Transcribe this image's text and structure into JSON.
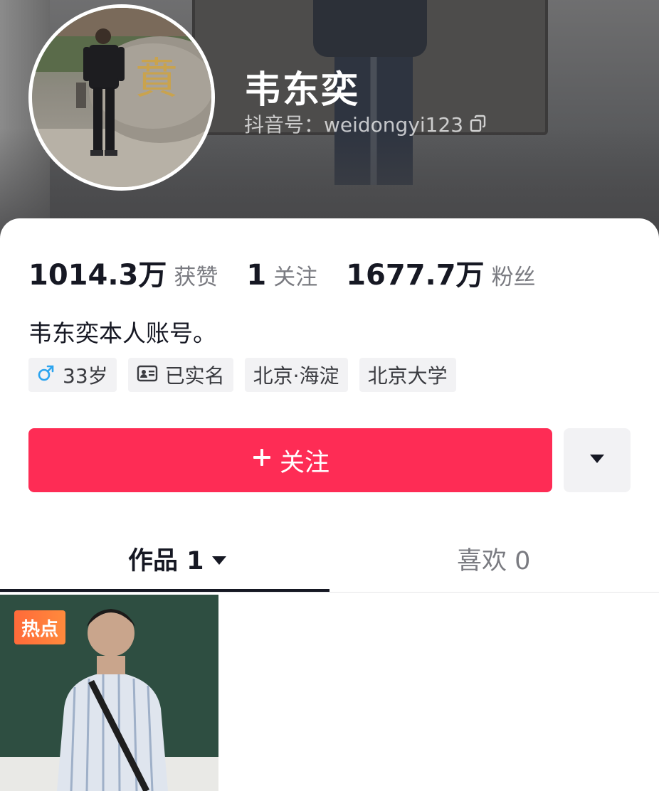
{
  "profile": {
    "name": "韦东奕",
    "account": "抖音号：weidongyi123",
    "bio": "韦东奕本人账号。"
  },
  "stats": [
    {
      "value": "1014.3万",
      "label": "获赞"
    },
    {
      "value": "1",
      "label": "关注"
    },
    {
      "value": "1677.7万",
      "label": "粉丝"
    }
  ],
  "tags": {
    "gender_age": "33岁",
    "verified": "已实名",
    "location": "北京·海淀",
    "school": "北京大学"
  },
  "actions": {
    "follow_label": "关注",
    "follow_icon": "plus-icon",
    "more_icon": "caret-down-icon"
  },
  "tabs": {
    "works": "作品 1",
    "likes": "喜欢 0"
  },
  "videos": [
    {
      "badge": "热点"
    }
  ],
  "colors": {
    "accent": "#fe2c55",
    "text": "#161823",
    "muted": "#7a7b81",
    "gender": "#2ca4ef",
    "hot_badge": "#ff6a3a"
  }
}
